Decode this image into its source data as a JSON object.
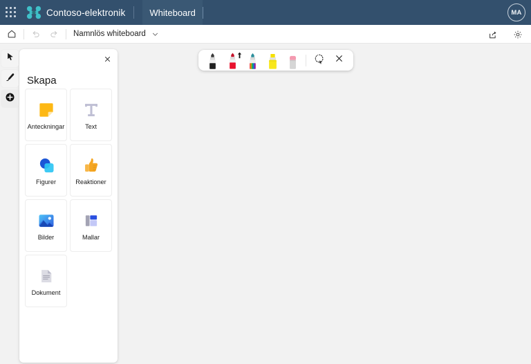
{
  "suite_bar": {
    "waffle_icon": "app-launcher-icon",
    "logo_icon": "contoso-logo-icon",
    "org_name": "Contoso-elektronik",
    "app_tab_label": "Whiteboard",
    "avatar_initials": "MA",
    "background_color": "#33506d"
  },
  "command_bar": {
    "home_icon": "home-icon",
    "undo_icon": "undo-icon",
    "redo_icon": "redo-icon",
    "document_title": "Namnlös whiteboard",
    "title_chevron_icon": "chevron-down-icon",
    "share_icon": "share-icon",
    "settings_icon": "gear-icon"
  },
  "rail": {
    "items": [
      {
        "name": "select-tool",
        "icon": "cursor-icon",
        "active": false
      },
      {
        "name": "pen-tool",
        "icon": "pen-icon",
        "active": false
      },
      {
        "name": "insert-tool",
        "icon": "plus-circle-icon",
        "active": true
      }
    ]
  },
  "create_panel": {
    "heading": "Skapa",
    "close_icon": "close-icon",
    "cards": [
      {
        "label": "Anteckningar",
        "icon": "sticky-note-icon"
      },
      {
        "label": "Text",
        "icon": "text-icon"
      },
      {
        "label": "Figurer",
        "icon": "shapes-icon"
      },
      {
        "label": "Reaktioner",
        "icon": "thumbs-up-icon"
      },
      {
        "label": "Bilder",
        "icon": "image-icon"
      },
      {
        "label": "Mallar",
        "icon": "templates-icon"
      },
      {
        "label": "Dokument",
        "icon": "document-icon"
      }
    ]
  },
  "ink_toolbar": {
    "tools": [
      {
        "name": "pen-black",
        "icon": "pen-black-icon",
        "color": "#1a1a1a",
        "selected": false
      },
      {
        "name": "pen-red",
        "icon": "pen-red-icon",
        "color": "#e8112d",
        "selected": true
      },
      {
        "name": "pen-rainbow",
        "icon": "pen-rainbow-icon",
        "color": "rainbow",
        "selected": false
      },
      {
        "name": "highlighter-yellow",
        "icon": "highlighter-yellow-icon",
        "color": "#f8e71c",
        "selected": false
      },
      {
        "name": "eraser",
        "icon": "eraser-icon",
        "color": "#f49ab0",
        "selected": false
      }
    ],
    "lasso_icon": "lasso-select-icon",
    "close_icon": "close-icon"
  },
  "canvas": {
    "background_color": "#f2f2f2"
  }
}
